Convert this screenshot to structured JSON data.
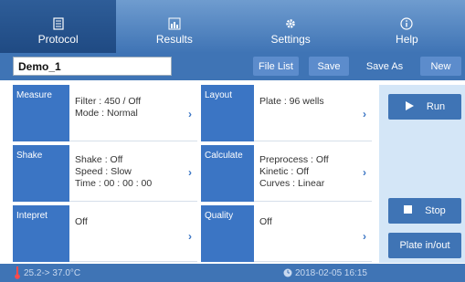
{
  "tabs": [
    {
      "label": "Protocol",
      "icon": "document-icon",
      "active": true
    },
    {
      "label": "Results",
      "icon": "chart-icon",
      "active": false
    },
    {
      "label": "Settings",
      "icon": "gear-icon",
      "active": false
    },
    {
      "label": "Help",
      "icon": "info-icon",
      "active": false
    }
  ],
  "toolbar": {
    "protocol_name": "Demo_1",
    "file_list_label": "File List",
    "save_label": "Save",
    "save_as_label": "Save As",
    "new_label": "New"
  },
  "grid": {
    "measure": {
      "label": "Measure",
      "line1": "Filter : 450 / Off",
      "line2": "Mode : Normal"
    },
    "layout": {
      "label": "Layout",
      "line1": "Plate :  96 wells"
    },
    "shake": {
      "label": "Shake",
      "line1": "Shake : Off",
      "line2": "Speed : Slow",
      "line3": "Time :  00 : 00 : 00"
    },
    "calculate": {
      "label": "Calculate",
      "line1": "Preprocess : Off",
      "line2": "Kinetic : Off",
      "line3": "Curves : Linear"
    },
    "intepret": {
      "label": "Intepret",
      "line1": "Off"
    },
    "quality": {
      "label": "Quality",
      "line1": "Off"
    }
  },
  "side": {
    "run_label": "Run",
    "stop_label": "Stop",
    "plate_label": "Plate in/out"
  },
  "status": {
    "temperature": "25.2-> 37.0°C",
    "datetime": "2018-02-05 16:15"
  },
  "colors": {
    "accent": "#3f74b5",
    "cell_label": "#3b75c4",
    "side_panel": "#d4e6f7"
  }
}
